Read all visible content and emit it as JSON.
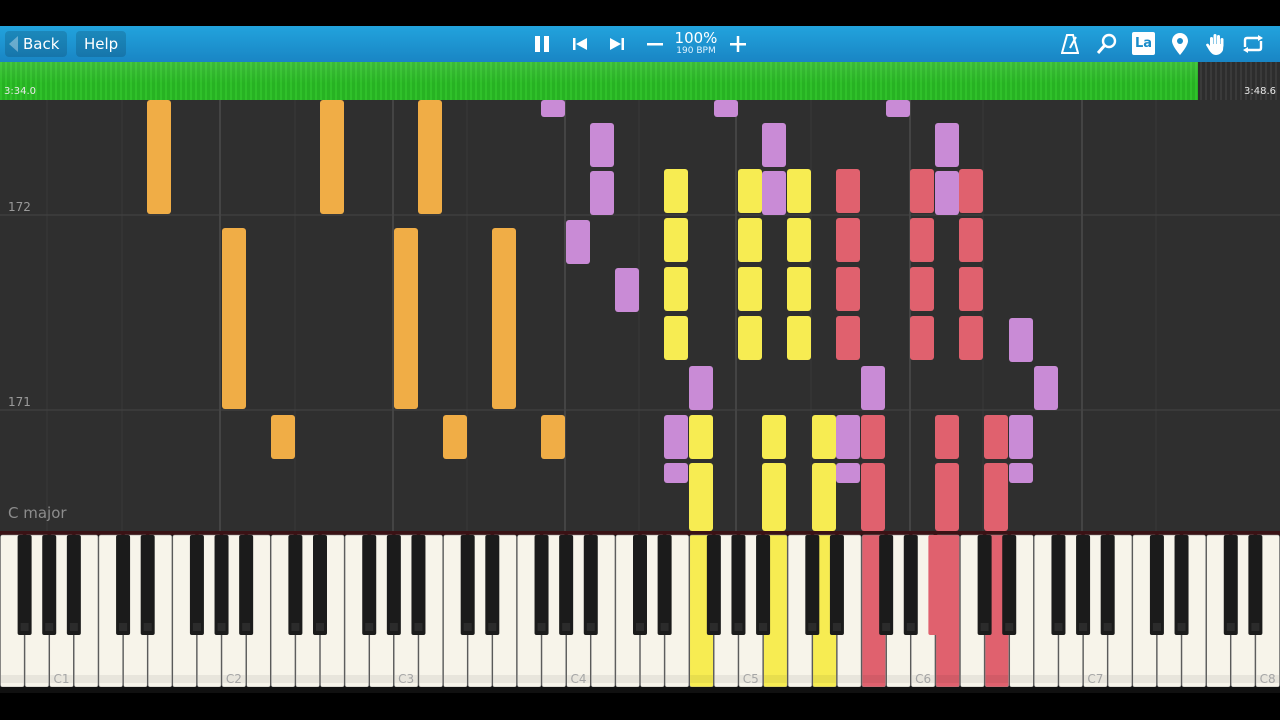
{
  "toolbar": {
    "back_label": "Back",
    "help_label": "Help",
    "speed_percent": "100%",
    "speed_bpm": "190 BPM",
    "la_icon_text": "La",
    "icons": [
      "pause-icon",
      "skip-back-icon",
      "skip-forward-icon",
      "minus-icon",
      "plus-icon",
      "metronome-icon",
      "magnifier-icon",
      "la-icon",
      "location-pin-icon",
      "hand-icon",
      "loop-icon"
    ]
  },
  "progress": {
    "current_time": "3:34.0",
    "total_time": "3:48.6",
    "played_fraction": 0.936
  },
  "roll": {
    "measures": [
      "172",
      "171"
    ],
    "key_signature": "C major"
  },
  "piano": {
    "octave_labels": [
      "C1",
      "C2",
      "C3",
      "C4",
      "C5",
      "C6",
      "C7",
      "C8"
    ]
  },
  "colors": {
    "toolbar": "#1b93d1",
    "progress_played": "#2ab826",
    "roll_background": "#2f2f2f",
    "note_orange": "#f0ad46",
    "note_yellow": "#f7ec52",
    "note_purple": "#c98bd6",
    "note_red": "#e0616e"
  }
}
